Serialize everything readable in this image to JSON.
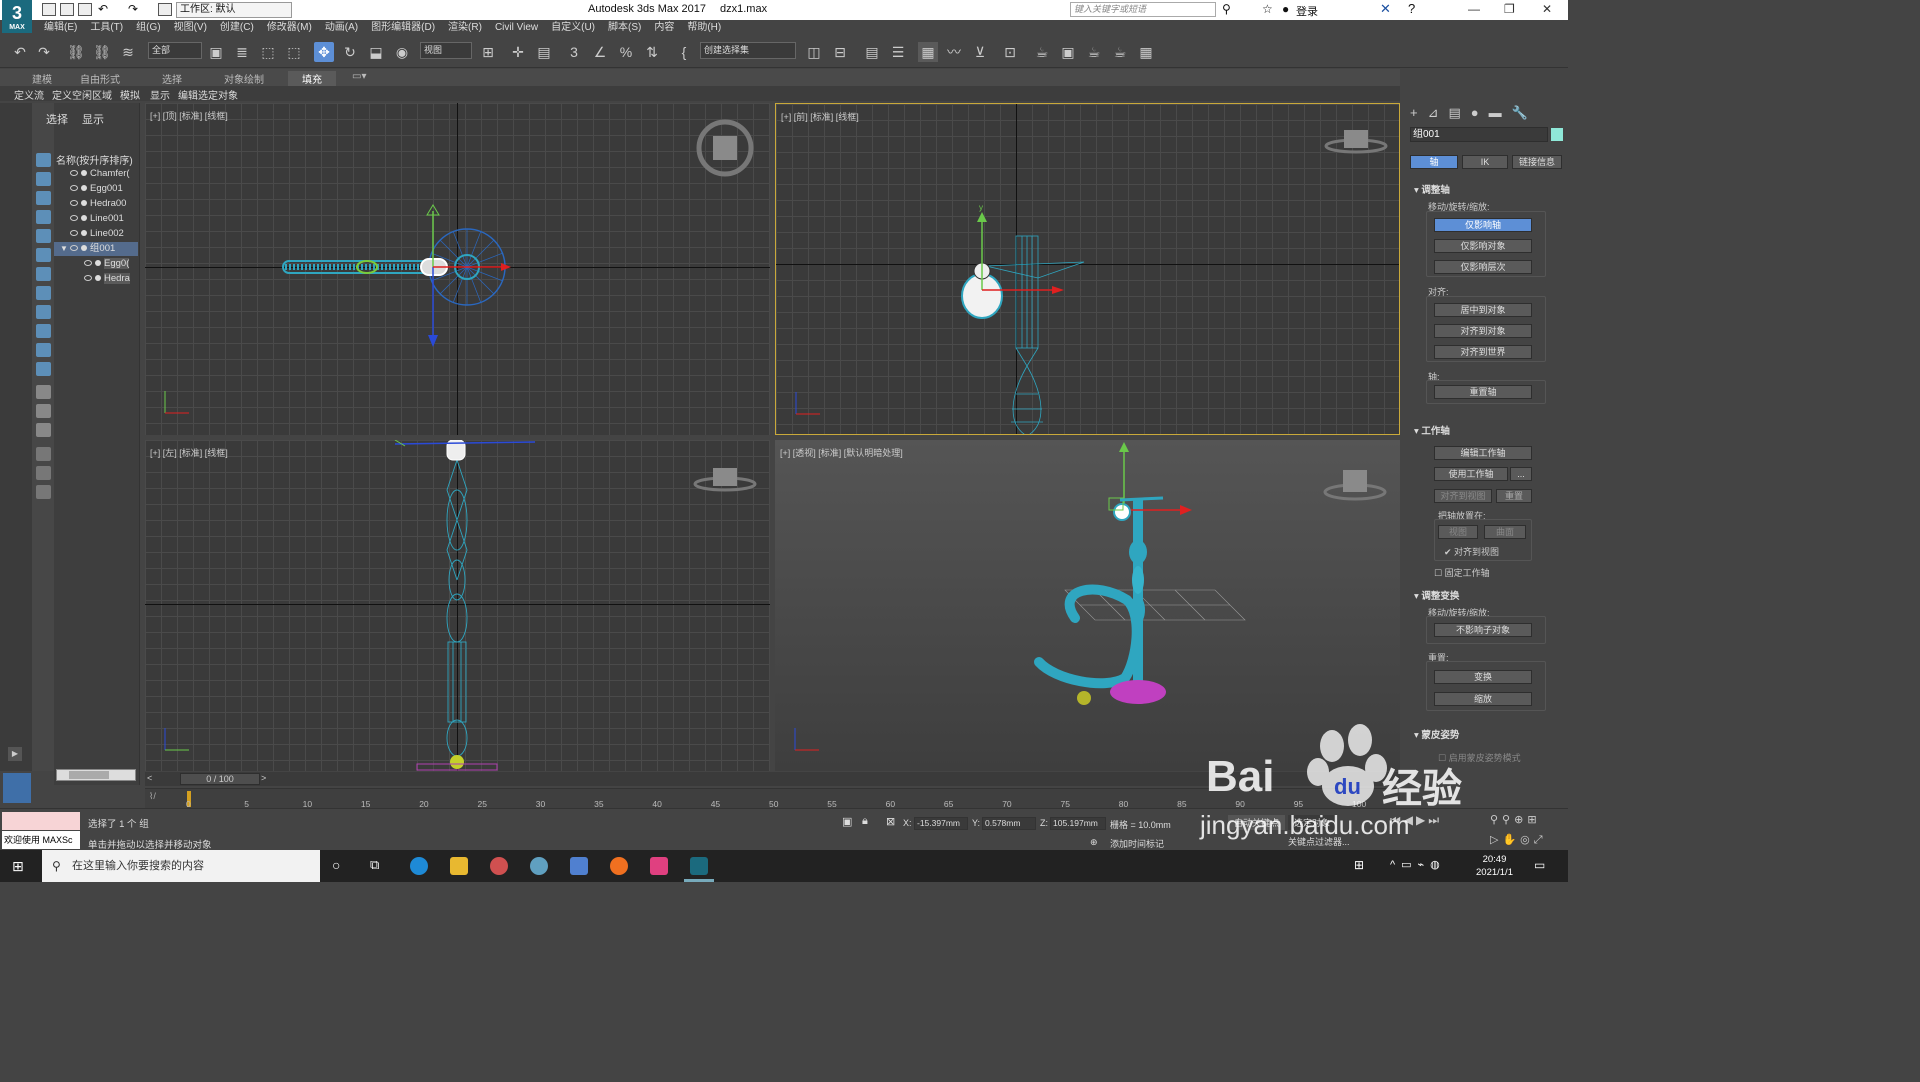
{
  "titlebar": {
    "workspace": "工作区: 默认",
    "app_title": "Autodesk 3ds Max 2017",
    "file_name": "dzx1.max",
    "search_placeholder": "键入关键字或短语",
    "login": "登录",
    "logo_top": "3",
    "logo_bottom": "MAX"
  },
  "menubar": [
    "编辑(E)",
    "工具(T)",
    "组(G)",
    "视图(V)",
    "创建(C)",
    "修改器(M)",
    "动画(A)",
    "图形编辑器(D)",
    "渲染(R)",
    "Civil View",
    "自定义(U)",
    "脚本(S)",
    "内容",
    "帮助(H)"
  ],
  "toolbar": {
    "selection_filter": "全部",
    "ref_coord": "视图",
    "named_selection": "创建选择集"
  },
  "ribbon": {
    "tabs": [
      "建模",
      "自由形式",
      "选择",
      "对象绘制",
      "填充"
    ],
    "sub_items": [
      "定义流",
      "定义空闲区域",
      "模拟",
      "显示",
      "编辑选定对象"
    ]
  },
  "explorer": {
    "tab_select": "选择",
    "tab_display": "显示",
    "column_header": "名称(按升序排序)",
    "items": [
      {
        "name": "Chamfer("
      },
      {
        "name": "Egg001"
      },
      {
        "name": "Hedra00"
      },
      {
        "name": "Line001"
      },
      {
        "name": "Line002"
      },
      {
        "name": "组001"
      },
      {
        "name": "Egg0("
      },
      {
        "name": "Hedra"
      }
    ]
  },
  "viewports": {
    "top": "[+] [顶] [标准] [线框]",
    "front": "[+] [前] [标准] [线框]",
    "left": "[+] [左] [标准] [线框]",
    "perspective": "[+] [透视] [标准] [默认明暗处理]"
  },
  "command_panel": {
    "object_name": "组001",
    "tabs": [
      "轴",
      "IK",
      "链接信息"
    ],
    "adjust_pivot": "调整轴",
    "move_rotate_scale": "移动/旋转/缩放:",
    "affect_pivot_only": "仅影响轴",
    "affect_object_only": "仅影响对象",
    "affect_hierarchy_only": "仅影响层次",
    "align_label": "对齐:",
    "center_to_object": "居中到对象",
    "align_to_object": "对齐到对象",
    "align_to_world": "对齐到世界",
    "pivot_label": "轴:",
    "reset_pivot": "重置轴",
    "working_pivot": "工作轴",
    "edit_working_pivot": "编辑工作轴",
    "use_working_pivot": "使用工作轴",
    "more": "...",
    "align_to_view": "对齐到视图",
    "reset": "重置",
    "place_pivot_to": "把轴放置在:",
    "view": "视图",
    "surface": "曲面",
    "align_to_view_check": "对齐到视图",
    "fixed_working_pivot": "固定工作轴",
    "adjust_transform": "调整变换",
    "move_rotate_scale2": "移动/旋转/缩放:",
    "dont_affect_children": "不影响子对象",
    "reset_label": "重置:",
    "transform": "变换",
    "scale": "缩放",
    "skin_pose": "蒙皮姿势",
    "skin_pose_mode": "启用蒙皮姿势模式"
  },
  "timeline": {
    "frame": "0 / 100",
    "ticks": [
      "0",
      "5",
      "10",
      "15",
      "20",
      "25",
      "30",
      "35",
      "40",
      "45",
      "50",
      "55",
      "60",
      "65",
      "70",
      "75",
      "80",
      "85",
      "90",
      "95",
      "100"
    ]
  },
  "status": {
    "maxscript": "欢迎使用 MAXSc",
    "selected": "选择了 1 个 组",
    "prompt": "单击并拖动以选择并移动对象",
    "x_label": "X:",
    "x_value": "-15.397mm",
    "y_label": "Y:",
    "y_value": "0.578mm",
    "z_label": "Z:",
    "z_value": "105.197mm",
    "grid": "栅格 = 10.0mm",
    "add_time_tag": "添加时间标记",
    "auto_key": "自动关键点",
    "set_key": "选定对象",
    "key_filters": "关键点过滤器..."
  },
  "taskbar": {
    "search_placeholder": "在这里输入你要搜索的内容",
    "time": "20:49",
    "date": "2021/1/1"
  },
  "watermark": {
    "text1": "Bai",
    "text2": "du",
    "text3": "经验",
    "url": "jingyan.baidu.com"
  },
  "colors": {
    "accent": "#5d8fd6",
    "wire": "#22c8d8",
    "object_teal": "#2fa6c0",
    "selection_white": "#ffffff",
    "front_border": "#c9a93a"
  }
}
